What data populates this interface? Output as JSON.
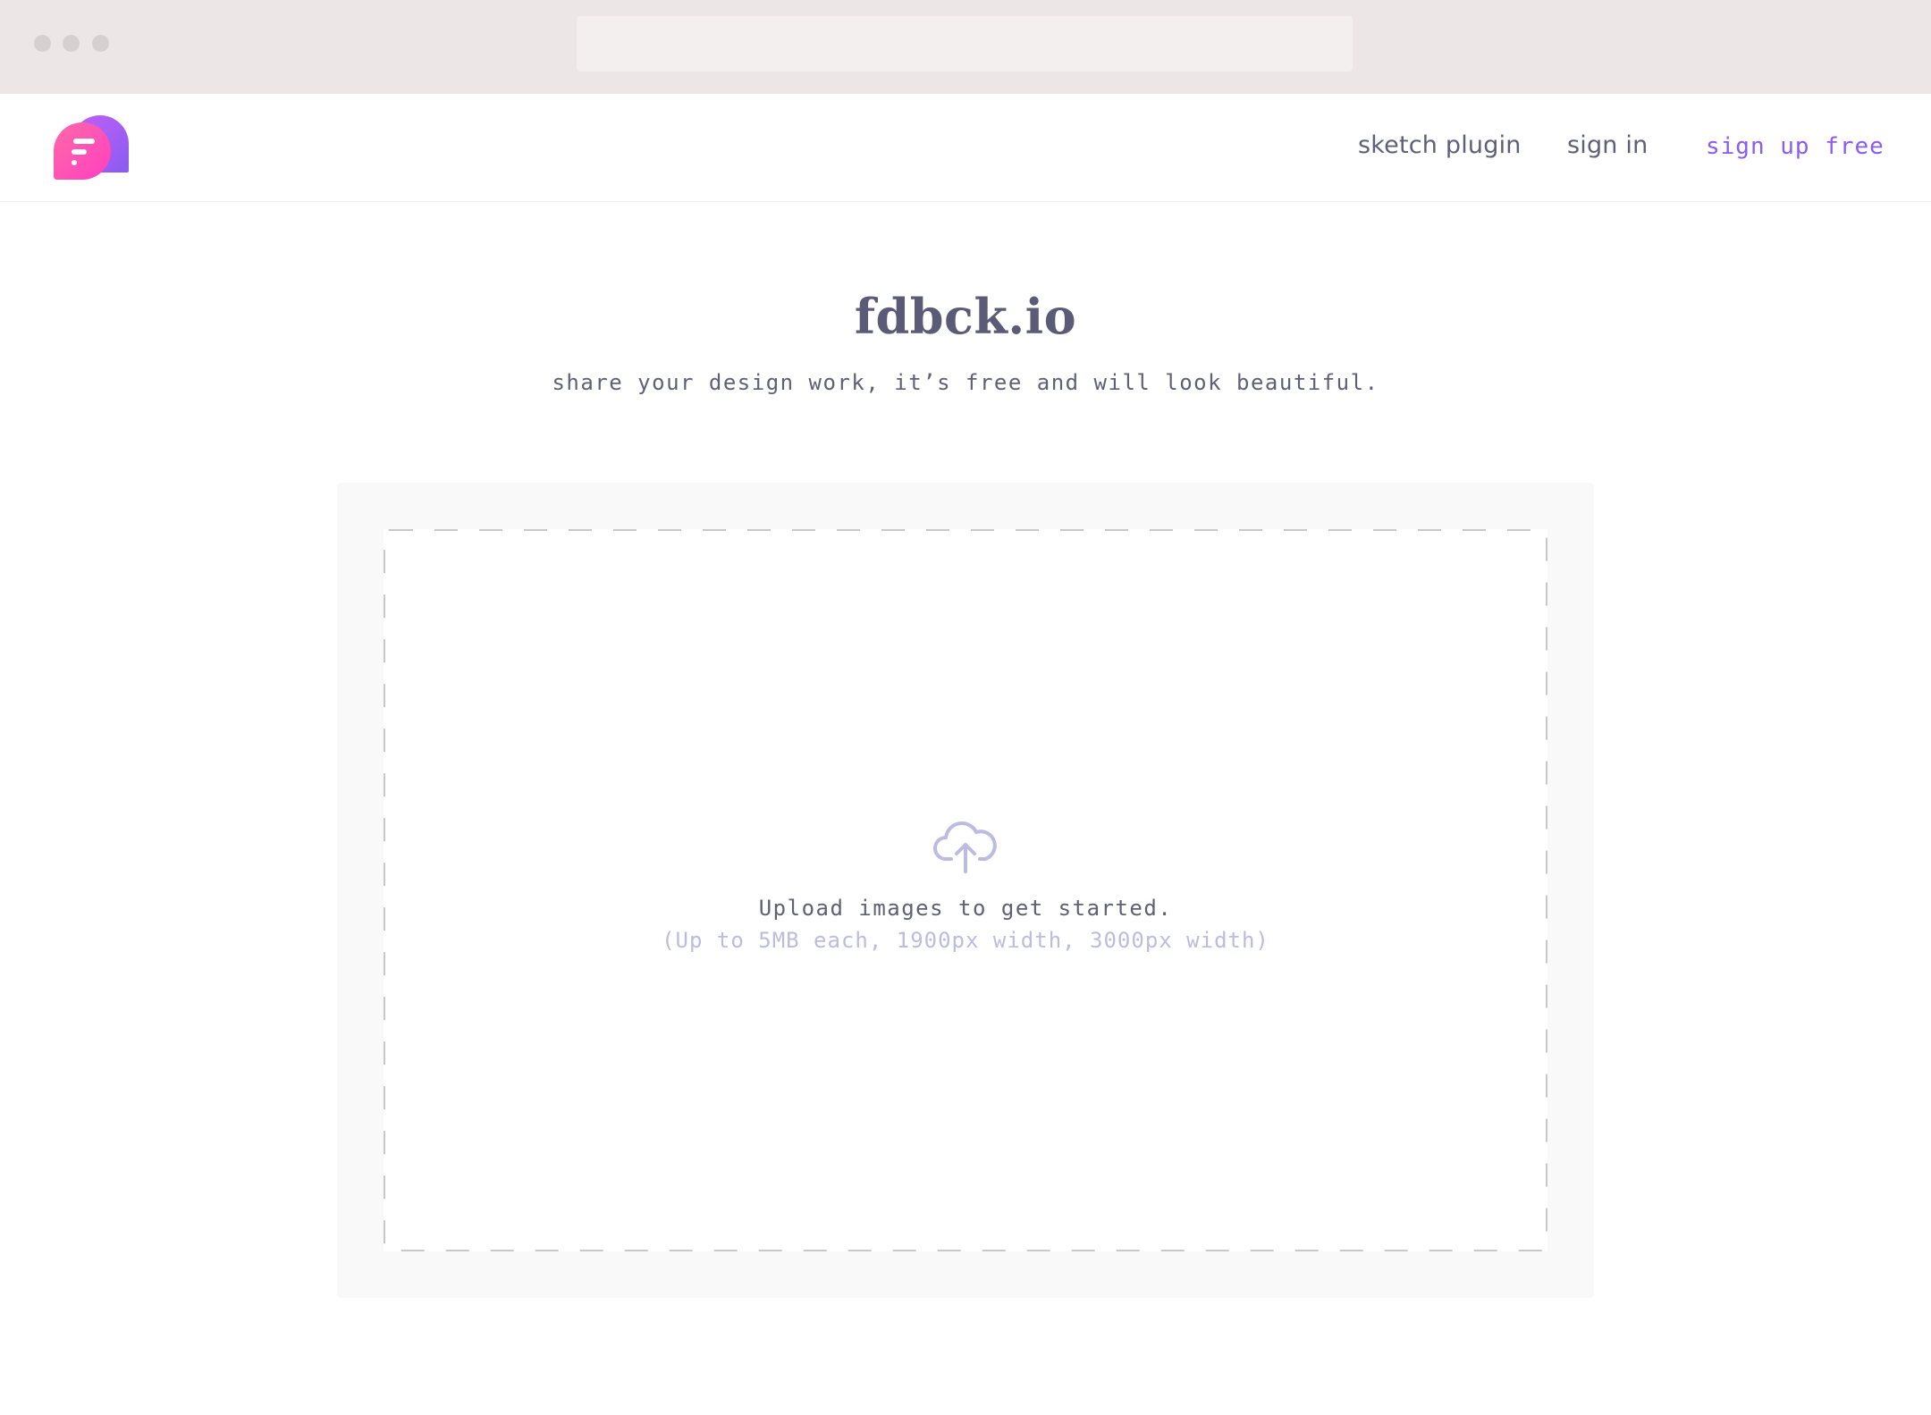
{
  "nav": {
    "sketch_plugin": "sketch plugin",
    "sign_in": "sign in",
    "sign_up": "sign up free"
  },
  "hero": {
    "title": "fdbck.io",
    "subtitle": "share your design work, it’s free and will look beautiful."
  },
  "upload": {
    "icon": "cloud-upload-icon",
    "prompt": "Upload images to get started.",
    "limits": "(Up to 5MB each, 1900px width, 3000px width)"
  },
  "colors": {
    "accent": "#8a5cf0",
    "text": "#5f5f76",
    "muted": "#bdbbe0",
    "logo_pink": "#ff4fa6",
    "logo_purple": "#a35cf5"
  }
}
